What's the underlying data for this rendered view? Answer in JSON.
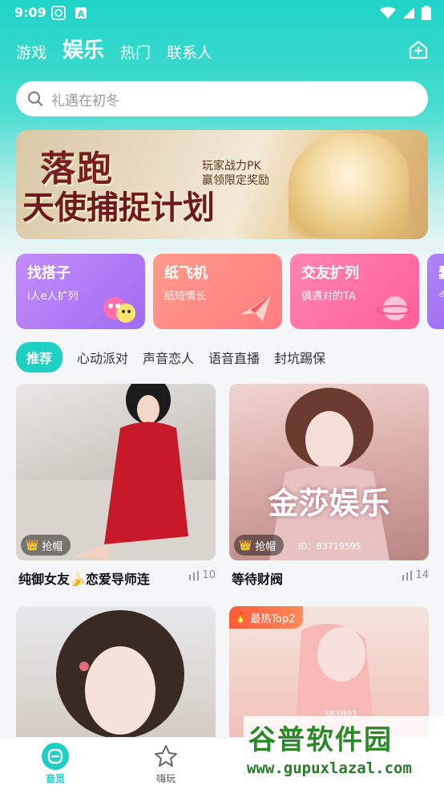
{
  "status": {
    "time": "9:09"
  },
  "top_tabs": [
    {
      "label": "游戏"
    },
    {
      "label": "娱乐"
    },
    {
      "label": "热门"
    },
    {
      "label": "联系人"
    }
  ],
  "search": {
    "placeholder": "礼遇在初冬"
  },
  "banner": {
    "title_line1": "落跑",
    "title_line2": "天使捕捉计划",
    "subtitle_line1": "玩家战力PK",
    "subtitle_line2": "赢领限定奖励"
  },
  "feature_cards": [
    {
      "title": "找搭子",
      "subtitle": "i人e人扩列",
      "color": "#b77cf6"
    },
    {
      "title": "纸飞机",
      "subtitle": "纸短情长",
      "color": "#ff8a7a"
    },
    {
      "title": "交友扩列",
      "subtitle": "偶遇对的TA",
      "color": "#ff6fa6"
    },
    {
      "title": "蠢",
      "subtitle": "今",
      "color": "#9a6cf0"
    }
  ],
  "sub_tabs": [
    {
      "label": "推荐"
    },
    {
      "label": "心动派对"
    },
    {
      "label": "声音恋人"
    },
    {
      "label": "语音直播"
    },
    {
      "label": "封坑踢保"
    }
  ],
  "rooms": [
    {
      "name": "纯御女友🍌恋爱导师连",
      "badge": "抢帽",
      "count": "10"
    },
    {
      "name": "等待财阀",
      "badge": "抢帽",
      "count": "14",
      "art_text": "金莎娱乐",
      "art_id": "ID：83719595"
    },
    {
      "name": "",
      "badge": "",
      "count": ""
    },
    {
      "name": "",
      "hot_badge": "最热Top2",
      "art_id": "383891"
    }
  ],
  "bottom_nav": [
    {
      "label": "音觅"
    },
    {
      "label": "嗨玩"
    }
  ],
  "watermark": {
    "line1": "谷普软件园",
    "line2": "www.gupuxlazal.com"
  },
  "colors": {
    "accent": "#1fcfc4",
    "header_top": "#1fd3c8"
  }
}
